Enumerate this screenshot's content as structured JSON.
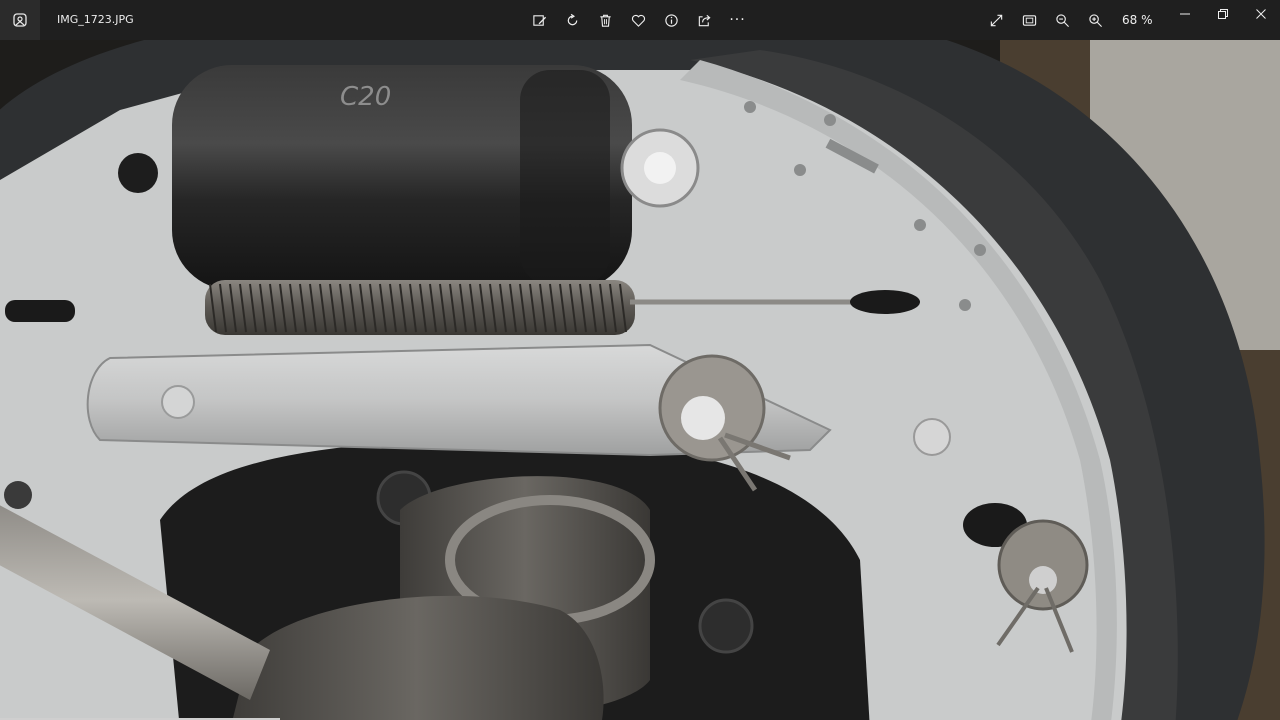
{
  "window": {
    "filename": "IMG_1723.JPG"
  },
  "toolbar": {
    "center_icons": [
      "edit-image-icon",
      "rotate-icon",
      "delete-icon",
      "favorite-icon",
      "info-icon",
      "share-icon",
      "more-icon"
    ],
    "more_label": "···",
    "right_icons": [
      "expand-icon",
      "fit-window-icon",
      "zoom-out-icon",
      "zoom-in-icon"
    ],
    "zoom_level": "68 %"
  },
  "photo": {
    "cylinder_marking": "C20",
    "colors": {
      "backing_plate": "#c9cbcb",
      "cylinder": "#2a2a2a",
      "drum": "#2e3032",
      "spring": "#6e6b66"
    }
  }
}
